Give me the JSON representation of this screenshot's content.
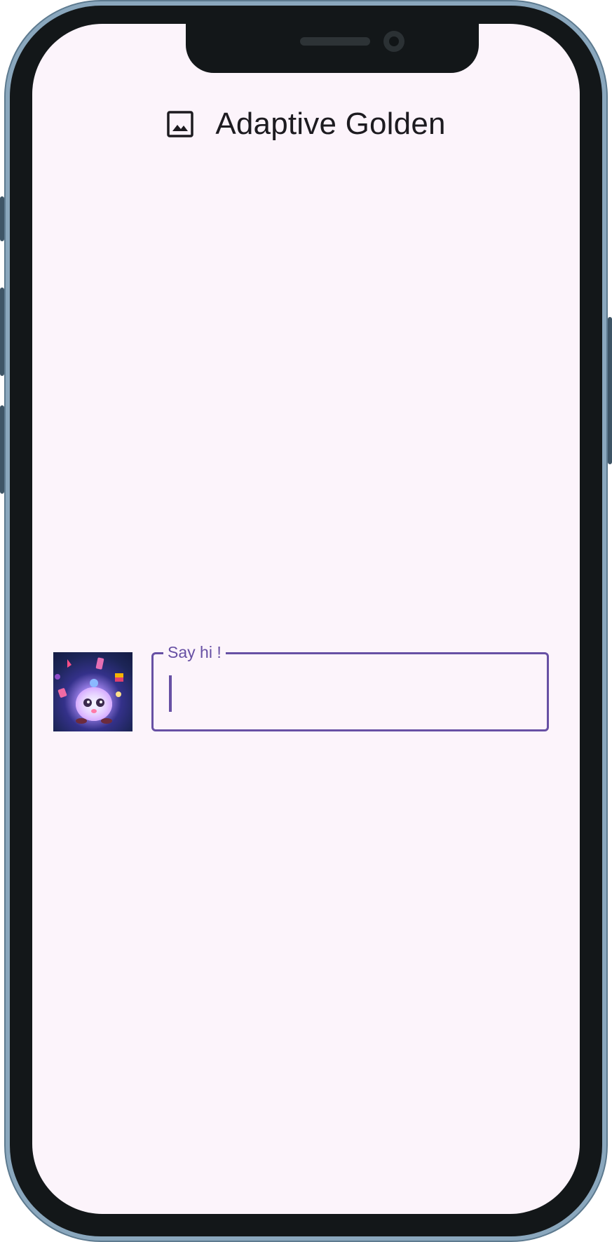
{
  "app_bar": {
    "icon": "image-icon",
    "title": "Adaptive Golden"
  },
  "thumbnail": {
    "description_icon": "avatar-robot-icon"
  },
  "input": {
    "label": "Say hi !",
    "value": ""
  },
  "colors": {
    "accent": "#6750a4",
    "background": "#fcf4fb",
    "title_text": "#1d1b20",
    "frame": "#8aa7bd",
    "bezel": "#131719"
  }
}
